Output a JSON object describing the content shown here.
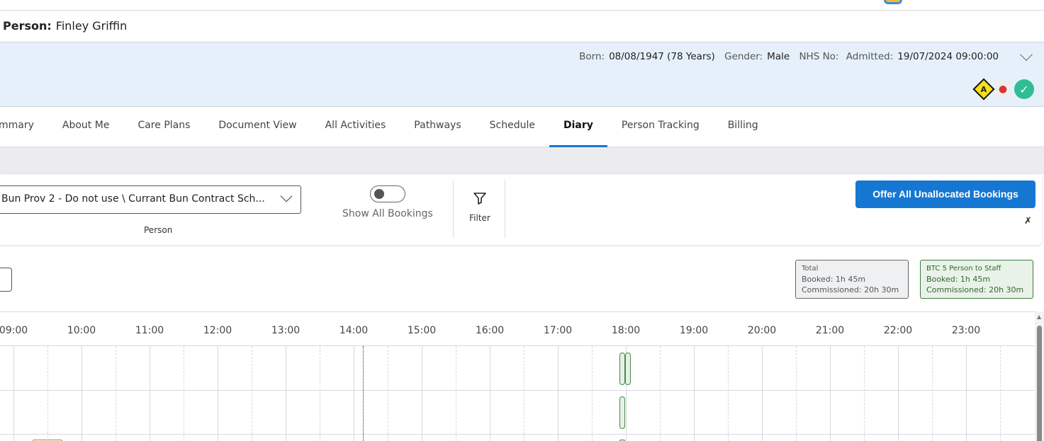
{
  "header": {
    "title_label": "Person:",
    "title_value": "Finley Griffin"
  },
  "banner": {
    "born_label": "Born:",
    "born_value": "08/08/1947 (78 Years)",
    "gender_label": "Gender:",
    "gender_value": "Male",
    "nhs_label": "NHS No:",
    "admitted_label": "Admitted:",
    "admitted_value": "19/07/2024 09:00:00",
    "alert_letter": "A"
  },
  "tabs": [
    {
      "label": "mmary"
    },
    {
      "label": "About Me"
    },
    {
      "label": "Care Plans"
    },
    {
      "label": "Document View"
    },
    {
      "label": "All Activities"
    },
    {
      "label": "Pathways"
    },
    {
      "label": "Schedule"
    },
    {
      "label": "Diary",
      "active": true
    },
    {
      "label": "Person Tracking"
    },
    {
      "label": "Billing"
    }
  ],
  "toolbar": {
    "person_select_value": "Bun Prov 2 - Do not use \\ Currant Bun Contract Sch...",
    "person_label": "Person",
    "show_all_label": "Show All Bookings",
    "show_all_on": false,
    "filter_label": "Filter",
    "offer_label": "Offer All Unallocated Bookings"
  },
  "summary": {
    "total": {
      "title": "Total",
      "booked": "Booked: 1h 45m",
      "commissioned": "Commissioned: 20h 30m"
    },
    "btc": {
      "title": "BTC 5 Person to Staff",
      "booked": "Booked: 1h 45m",
      "commissioned": "Commissioned: 20h 30m"
    }
  },
  "timeline": {
    "hours": [
      "09:00",
      "10:00",
      "11:00",
      "12:00",
      "13:00",
      "14:00",
      "15:00",
      "16:00",
      "17:00",
      "18:00",
      "19:00",
      "20:00",
      "21:00",
      "22:00",
      "23:00"
    ],
    "now": "14:08",
    "bookings": [
      {
        "row": 0,
        "start": "17:55"
      },
      {
        "row": 0,
        "start": "18:00"
      },
      {
        "row": 1,
        "start": "17:55"
      },
      {
        "row": 2,
        "start": "17:55"
      }
    ]
  },
  "colors": {
    "accent": "#1677d2",
    "booking": "#4a8a4a",
    "banner": "#e6f0fa"
  }
}
